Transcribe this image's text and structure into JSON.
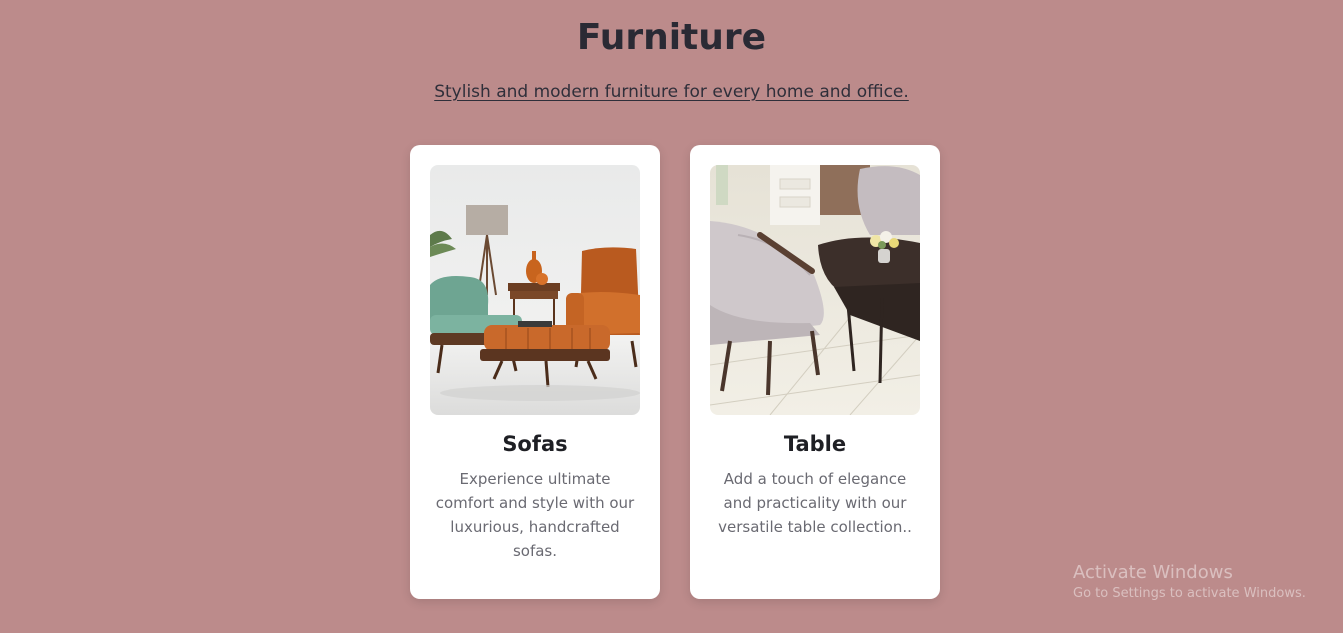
{
  "page": {
    "title": "Furniture",
    "subtitle": "Stylish and modern furniture for every home and office."
  },
  "cards": [
    {
      "title": "Sofas",
      "description": "Experience ultimate comfort and style with our luxurious, handcrafted sofas.",
      "image_icon": "sofa-set-photo"
    },
    {
      "title": "Table",
      "description": "Add a touch of elegance and practicality with our versatile table collection..",
      "image_icon": "dining-table-photo"
    }
  ],
  "watermark": {
    "title": "Activate Windows",
    "subtitle": "Go to Settings to activate Windows."
  },
  "colors": {
    "background": "#bc8b8b",
    "card": "#ffffff",
    "title": "#2a2a34",
    "body_text": "#6a6a72"
  }
}
